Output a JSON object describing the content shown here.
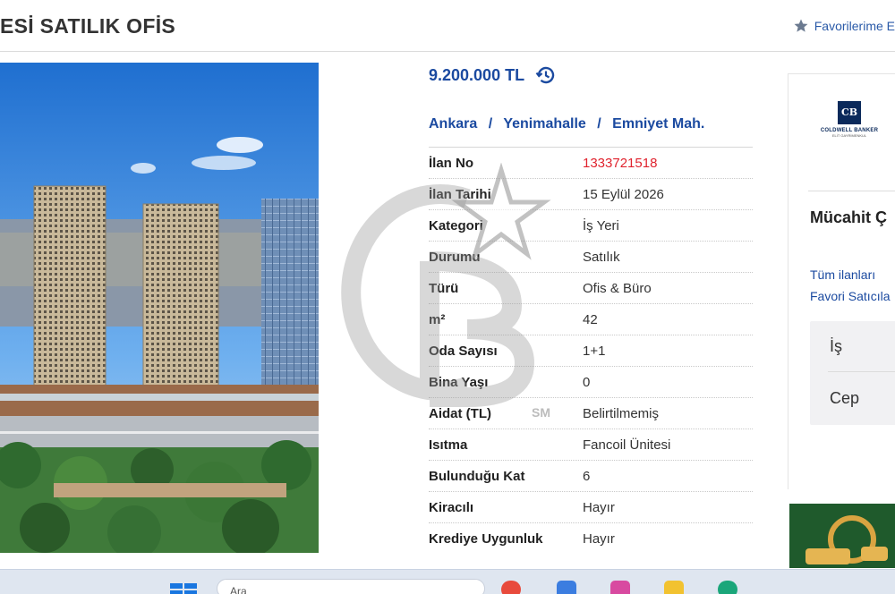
{
  "header": {
    "title": "ESİ SATILIK OFİS",
    "favorites_label": "Favorilerime E"
  },
  "listing": {
    "price": "9.200.000 TL",
    "breadcrumb": [
      "Ankara",
      "Yenimahalle",
      "Emniyet Mah."
    ],
    "breadcrumb_separator": "/",
    "details": [
      {
        "key": "İlan No",
        "value": "1333721518"
      },
      {
        "key": "İlan Tarihi",
        "value": "15 Eylül 2026"
      },
      {
        "key": "Kategori",
        "value": "İş Yeri"
      },
      {
        "key": "Durumu",
        "value": "Satılık"
      },
      {
        "key": "Türü",
        "value": "Ofis & Büro"
      },
      {
        "key": "m²",
        "value": "42"
      },
      {
        "key": "Oda Sayısı",
        "value": "1+1"
      },
      {
        "key": "Bina Yaşı",
        "value": "0"
      },
      {
        "key": "Aidat (TL)",
        "value": "Belirtilmemiş"
      },
      {
        "key": "Isıtma",
        "value": "Fancoil Ünitesi"
      },
      {
        "key": "Bulunduğu Kat",
        "value": "6"
      },
      {
        "key": "Kiracılı",
        "value": "Hayır"
      },
      {
        "key": "Krediye Uygunluk",
        "value": "Hayır"
      }
    ]
  },
  "agent": {
    "office_logo_text": "COLDWELL BANKER",
    "office_logo_sub": "ELİT GAYRİMENKUL",
    "office_logo_mark": "CB",
    "name": "Mücahit Ç",
    "all_listings_link": "Tüm ilanları",
    "favorite_seller_link": "Favori Satıcıla",
    "phone_labels": [
      "İş",
      "Cep"
    ]
  },
  "watermark": {
    "sm_mark": "SM"
  },
  "taskbar": {
    "search_placeholder": "Ara"
  },
  "colors": {
    "price_blue": "#1b4aa0",
    "listing_no_red": "#e0232e",
    "brand_navy": "#0b2a5b"
  },
  "icons": {
    "favorites": "star-icon",
    "price_history": "history-icon"
  }
}
